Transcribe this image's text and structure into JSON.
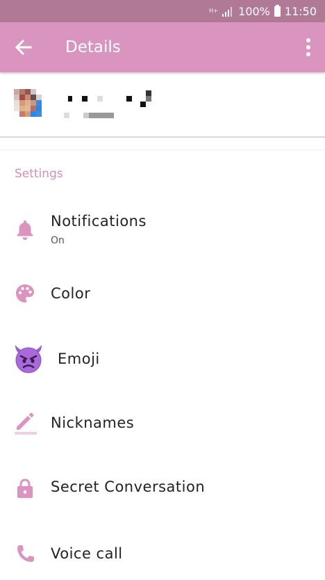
{
  "status_bar": {
    "network": "H+",
    "battery": "100%",
    "time": "11:50"
  },
  "app_bar": {
    "title": "Details",
    "back_icon": "arrow-left-icon",
    "menu_icon": "more-vert-icon"
  },
  "section": {
    "title": "Settings"
  },
  "items": [
    {
      "label": "Notifications",
      "sub": "On",
      "icon": "bell-icon"
    },
    {
      "label": "Color",
      "icon": "palette-icon"
    },
    {
      "label": "Emoji",
      "icon": "devil-emoji-icon"
    },
    {
      "label": "Nicknames",
      "icon": "pencil-icon"
    },
    {
      "label": "Secret Conversation",
      "icon": "lock-icon"
    },
    {
      "label": "Voice call",
      "icon": "phone-icon"
    }
  ],
  "colors": {
    "status_bar": "#b07a96",
    "app_bar": "#d994bf",
    "accent": "#d48fbb"
  }
}
